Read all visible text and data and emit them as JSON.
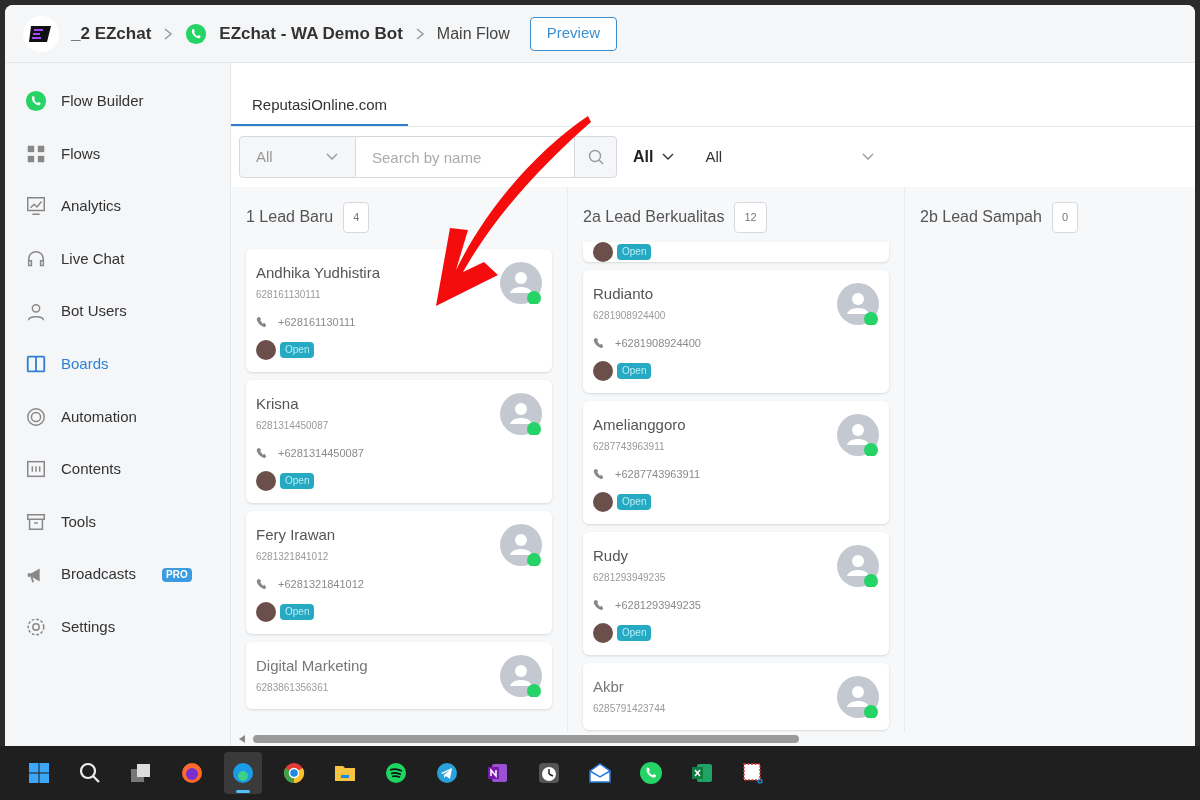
{
  "breadcrumb": [
    {
      "label": "_2 EZchat",
      "kind": "workspace"
    },
    {
      "label": "EZchat - WA Demo Bot",
      "kind": "bot"
    },
    {
      "label": "Main Flow",
      "kind": "page"
    }
  ],
  "preview_button": "Preview",
  "sidebar": {
    "items": [
      {
        "label": "Flow Builder",
        "selected": false
      },
      {
        "label": "Flows",
        "selected": false
      },
      {
        "label": "Analytics",
        "selected": false
      },
      {
        "label": "Live Chat",
        "selected": false
      },
      {
        "label": "Bot Users",
        "selected": false
      },
      {
        "label": "Boards",
        "selected": true
      },
      {
        "label": "Automation",
        "selected": false
      },
      {
        "label": "Contents",
        "selected": false
      },
      {
        "label": "Tools",
        "selected": false
      },
      {
        "label": "Broadcasts",
        "selected": false,
        "badge": "PRO"
      },
      {
        "label": "Settings",
        "selected": false
      }
    ]
  },
  "tabs": [
    {
      "label": "ReputasiOnline.com",
      "selected": true
    }
  ],
  "filters": {
    "select_1": "All",
    "search": {
      "placeholder": "Search by name"
    },
    "select_2": "All",
    "select_3": "All"
  },
  "columns": [
    {
      "title": "1 Lead Baru",
      "count": "4",
      "cards": [
        {
          "name": "Andhika Yudhistira",
          "id": "628161130111",
          "phone": "+628161130111",
          "status": "Open"
        },
        {
          "name": "Krisna",
          "id": "6281314450087",
          "phone": "+6281314450087",
          "status": "Open"
        },
        {
          "name": "Fery Irawan",
          "id": "6281321841012",
          "phone": "+6281321841012",
          "status": "Open"
        },
        {
          "name": "Digital Marketing",
          "id": "6283861356361"
        }
      ]
    },
    {
      "title": "2a Lead Berkualitas",
      "count": "12",
      "partial_card": {
        "status": "Open"
      },
      "cards": [
        {
          "name": "Rudianto",
          "id": "6281908924400",
          "phone": "+6281908924400",
          "status": "Open"
        },
        {
          "name": "Amelianggoro",
          "id": "6287743963911",
          "phone": "+6287743963911",
          "status": "Open"
        },
        {
          "name": "Rudy",
          "id": "6281293949235",
          "phone": "+6281293949235",
          "status": "Open"
        },
        {
          "name": "Akbr",
          "id": "6285791423744"
        }
      ]
    },
    {
      "title": "2b Lead Sampah",
      "count": "0"
    }
  ],
  "taskbar": [
    {
      "active": false
    },
    {
      "active": false
    },
    {
      "active": false
    },
    {
      "active": false
    },
    {
      "active": true
    },
    {
      "active": false
    },
    {
      "active": false
    },
    {
      "active": false
    },
    {
      "active": false
    },
    {
      "active": false
    },
    {
      "active": false
    },
    {
      "active": false
    },
    {
      "active": false
    },
    {
      "active": false
    },
    {
      "active": false
    }
  ]
}
